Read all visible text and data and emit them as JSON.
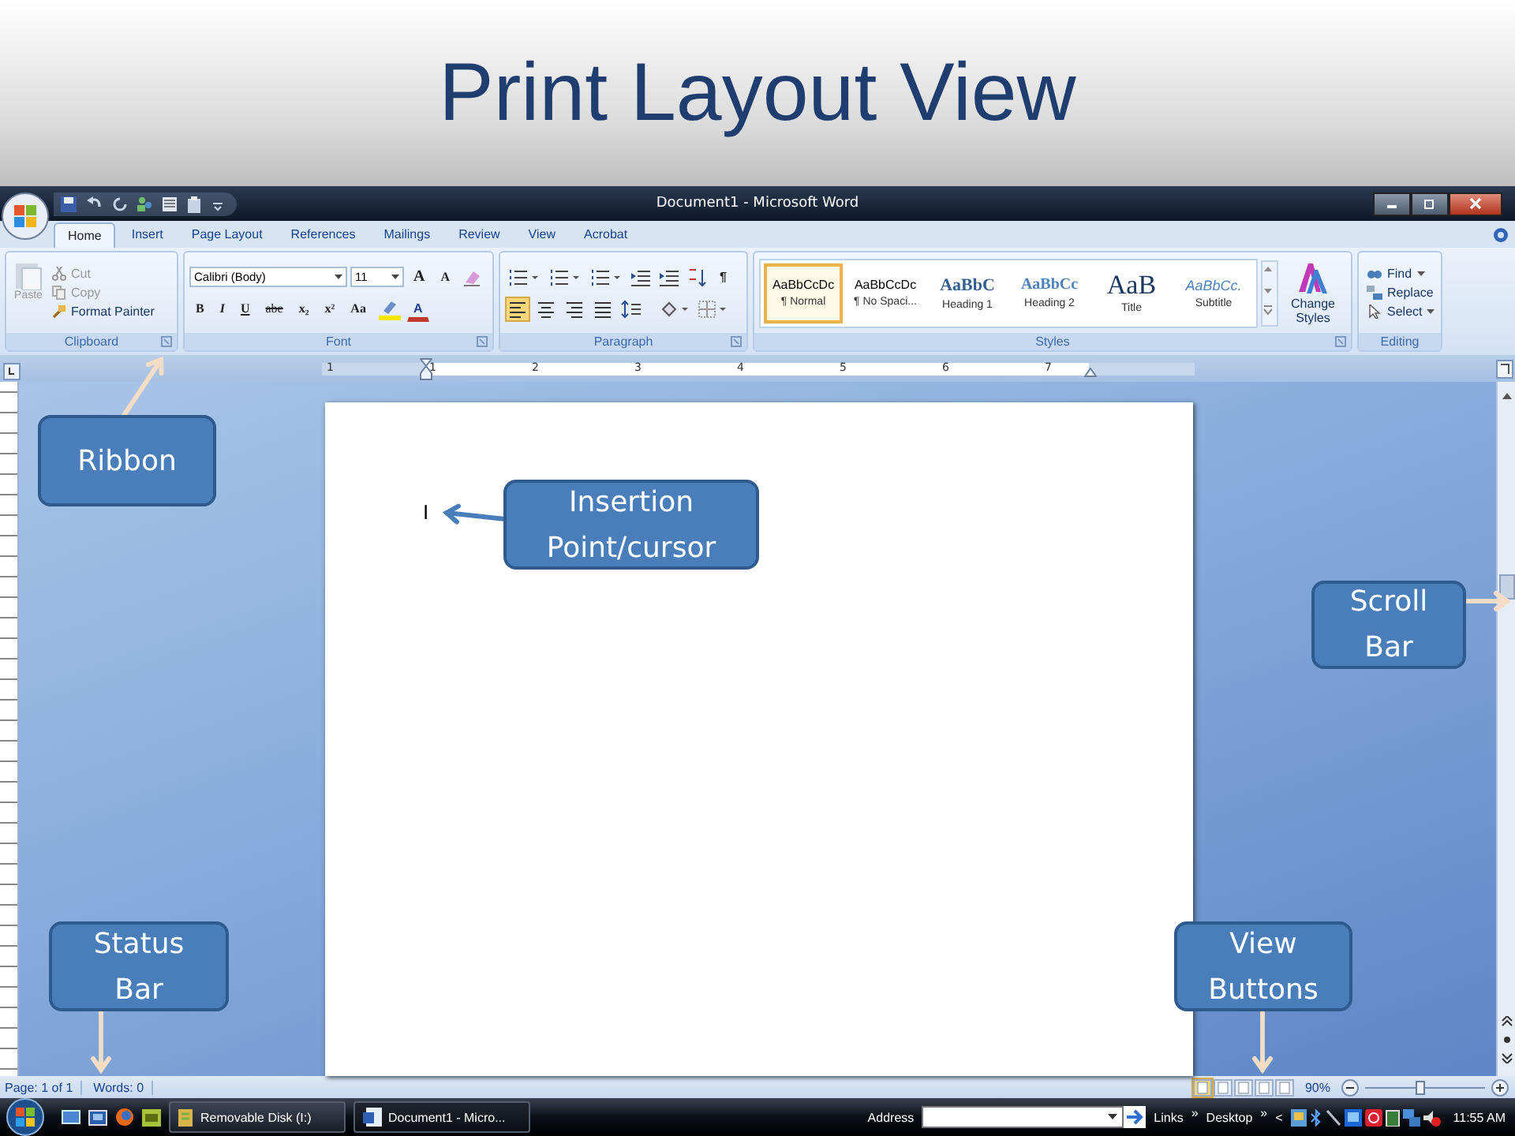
{
  "slide_title": "Print Layout View",
  "window": {
    "title": "Document1 - Microsoft Word"
  },
  "tabs": [
    {
      "label": "Home",
      "selected": true
    },
    {
      "label": "Insert",
      "selected": false
    },
    {
      "label": "Page Layout",
      "selected": false
    },
    {
      "label": "References",
      "selected": false
    },
    {
      "label": "Mailings",
      "selected": false
    },
    {
      "label": "Review",
      "selected": false
    },
    {
      "label": "View",
      "selected": false
    },
    {
      "label": "Acrobat",
      "selected": false
    }
  ],
  "clipboard": {
    "label": "Clipboard",
    "paste": "Paste",
    "cut": "Cut",
    "copy": "Copy",
    "format_painter": "Format Painter"
  },
  "font": {
    "label": "Font",
    "font_name": "Calibri (Body)",
    "font_size": "11",
    "grow": "A",
    "shrink": "A",
    "format_buttons": [
      "B",
      "I",
      "U",
      "abe",
      "x₂",
      "x²",
      "Aa"
    ],
    "font_color": "A"
  },
  "paragraph": {
    "label": "Paragraph",
    "pilcrow": "¶"
  },
  "styles": {
    "label": "Styles",
    "change_styles": "Change Styles",
    "items": [
      {
        "preview": "AaBbCcDc",
        "name": "¶ Normal",
        "kind": "normal",
        "selected": true
      },
      {
        "preview": "AaBbCcDc",
        "name": "¶ No Spaci...",
        "kind": "normal",
        "selected": false
      },
      {
        "preview": "AaBbC",
        "name": "Heading 1",
        "kind": "heading1",
        "selected": false
      },
      {
        "preview": "AaBbCc",
        "name": "Heading 2",
        "kind": "heading2",
        "selected": false
      },
      {
        "preview": "AaB",
        "name": "Title",
        "kind": "title",
        "selected": false
      },
      {
        "preview": "AaBbCc.",
        "name": "Subtitle",
        "kind": "subtitle",
        "selected": false
      }
    ]
  },
  "editing": {
    "label": "Editing",
    "find": "Find",
    "replace": "Replace",
    "select": "Select"
  },
  "ruler": {
    "labels": [
      "1",
      "1",
      "2",
      "3",
      "4",
      "5",
      "6",
      "7"
    ]
  },
  "document": {
    "cursor": "I"
  },
  "status_bar": {
    "page": "Page: 1 of 1",
    "words": "Words: 0",
    "zoom": "90%",
    "zoom_slider": {
      "level": 0.46
    },
    "view_buttons": [
      {
        "selected": true
      },
      {
        "selected": false
      },
      {
        "selected": false
      },
      {
        "selected": false
      },
      {
        "selected": false
      }
    ]
  },
  "taskbar": {
    "tasks": [
      {
        "label": "Removable Disk (I:)",
        "kind": "folder"
      },
      {
        "label": "Document1 - Micro...",
        "kind": "word"
      }
    ],
    "address": "Address",
    "links": "Links",
    "chevron_1": "»",
    "desktop": "Desktop",
    "chevron_2": "»",
    "tray_arrow": "<",
    "time": "11:55 AM"
  },
  "callouts": [
    {
      "text": "Ribbon"
    },
    {
      "text": "Insertion Point/cursor"
    },
    {
      "text": "Scroll Bar"
    },
    {
      "text": "Status Bar"
    },
    {
      "text": "View Buttons"
    }
  ]
}
